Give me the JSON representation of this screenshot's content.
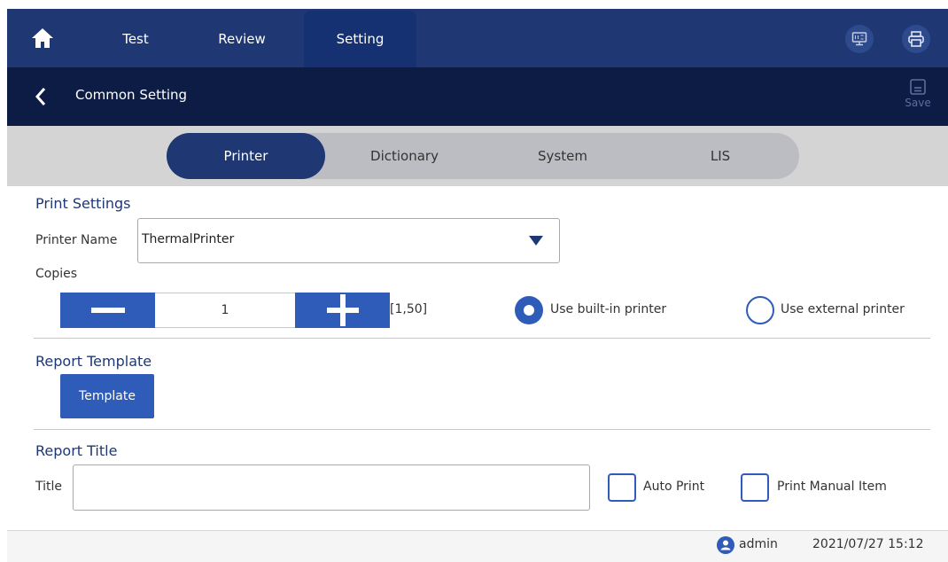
{
  "nav": {
    "tabs": [
      {
        "label": "Test",
        "active": false
      },
      {
        "label": "Review",
        "active": false
      },
      {
        "label": "Setting",
        "active": true
      }
    ],
    "icons": [
      "home-icon",
      "lis-monitor-icon",
      "printer-icon"
    ]
  },
  "header": {
    "title": "Common Setting",
    "save_label": "Save"
  },
  "segments": [
    {
      "label": "Printer",
      "active": true
    },
    {
      "label": "Dictionary",
      "active": false
    },
    {
      "label": "System",
      "active": false
    },
    {
      "label": "LIS",
      "active": false
    }
  ],
  "print_settings": {
    "section_title": "Print Settings",
    "printer_name_label": "Printer Name",
    "printer_name_value": "ThermalPrinter",
    "copies_label": "Copies",
    "copies_value": "1",
    "copies_range": "[1,50]",
    "radio_builtin_label": "Use built-in printer",
    "radio_external_label": "Use external printer",
    "selected_printer_mode": "built-in"
  },
  "report_template": {
    "section_title": "Report Template",
    "button_label": "Template"
  },
  "report_title": {
    "section_title": "Report Title",
    "title_label": "Title",
    "title_value": "",
    "auto_print_label": "Auto Print",
    "auto_print_checked": false,
    "print_manual_label": "Print Manual Item",
    "print_manual_checked": false
  },
  "status": {
    "user": "admin",
    "datetime": "2021/07/27 15:12"
  },
  "colors": {
    "nav_bg": "#1f3873",
    "subheader_bg": "#0d1c45",
    "accent": "#2f5cb8"
  }
}
